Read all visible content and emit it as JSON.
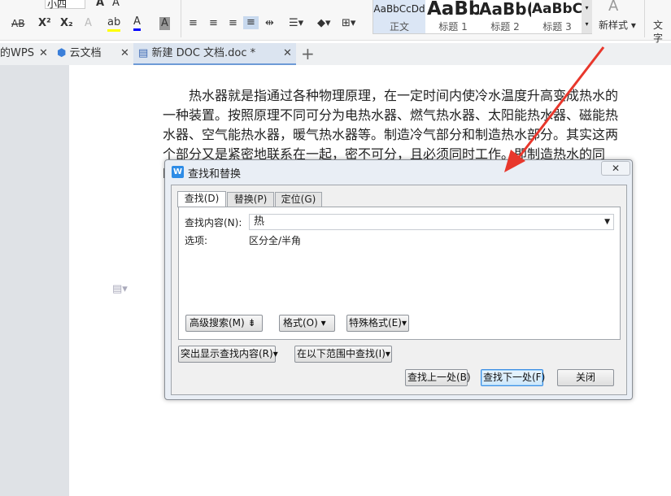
{
  "ribbon": {
    "font_size": "小四",
    "styles": [
      {
        "preview": "AaBbCcDd",
        "label": "正文"
      },
      {
        "preview": "AaBb",
        "label": "标题 1"
      },
      {
        "preview": "AaBb(",
        "label": "标题 2"
      },
      {
        "preview": "AaBbC",
        "label": "标题 3"
      }
    ],
    "new_style": "新样式",
    "text_tool": "文字"
  },
  "tabs": [
    {
      "label": "的WPS"
    },
    {
      "label": "云文档"
    },
    {
      "label": "新建 DOC 文档.doc *"
    }
  ],
  "document": {
    "paragraph": "热水器就是指通过各种物理原理，在一定时间内使冷水温度升高变成热水的一种装置。按照原理不同可分为电热水器、燃气热水器、太阳能热水器、磁能热水器、空气能热水器，暖气热水器等。制造冷气部分和制造热水部分。其实这两个部分又是紧密地联系在一起，密不可分，且必须同时工作。即制造热水的同时，"
  },
  "dialog": {
    "title": "查找和替换",
    "tabs": [
      "查找(D)",
      "替换(P)",
      "定位(G)"
    ],
    "find_label": "查找内容(N):",
    "find_value": "热",
    "options_label": "选项:",
    "options_value": "区分全/半角",
    "advanced": "高级搜索(M)",
    "format": "格式(O)",
    "special": "特殊格式(E)",
    "highlight": "突出显示查找内容(R)",
    "search_in": "在以下范围中查找(I)",
    "prev": "查找上一处(B)",
    "next": "查找下一处(F)",
    "close": "关闭"
  },
  "colors": {
    "arrow": "#e8372c",
    "accent": "#3c8ee4"
  }
}
